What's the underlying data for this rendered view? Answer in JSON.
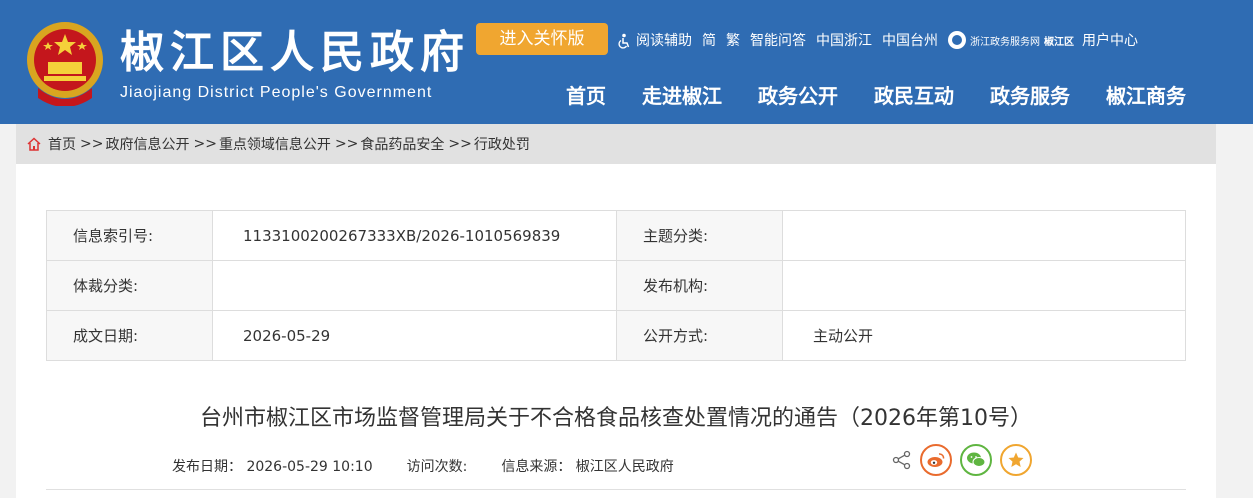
{
  "header": {
    "title": "椒江区人民政府",
    "subtitle": "Jiaojiang District People's Government",
    "care_button": "进入关怀版",
    "top_links": {
      "reading_aid": "阅读辅助",
      "simplified": "简",
      "traditional": "繁",
      "smart_qa": "智能问答",
      "china_zhejiang": "中国浙江",
      "china_taizhou": "中国台州",
      "zj_service": "浙江政务服务网",
      "zj_region": "椒江区",
      "user_center": "用户中心"
    },
    "nav": [
      "首页",
      "走进椒江",
      "政务公开",
      "政民互动",
      "政务服务",
      "椒江商务"
    ]
  },
  "breadcrumb": {
    "items": [
      "首页",
      "政府信息公开",
      "重点领域信息公开",
      "食品药品安全",
      "行政处罚"
    ],
    "separator": ">>"
  },
  "info": {
    "index_label": "信息索引号:",
    "index_value": "1133100200267333XB/2026-1010569839",
    "topic_label": "主题分类:",
    "topic_value": "",
    "genre_label": "体裁分类:",
    "genre_value": "",
    "issuer_label": "发布机构:",
    "issuer_value": "",
    "date_label": "成文日期:",
    "date_value": "2026-05-29",
    "disclosure_label": "公开方式:",
    "disclosure_value": "主动公开"
  },
  "article": {
    "title": "台州市椒江区市场监督管理局关于不合格食品核查处置情况的通告（2026年第10号）",
    "publish_date": "发布日期： 2026-05-29 10:10",
    "visits": "访问次数:",
    "source": "信息来源： 椒江区人民政府"
  },
  "colors": {
    "header_bg": "#2f6cb3",
    "care_button": "#f0a630",
    "weibo": "#e96b2e",
    "wechat": "#5fb541",
    "favorite": "#f0a630"
  },
  "icons": [
    "national-emblem-icon",
    "accessibility-icon",
    "zhejiang-globe-icon",
    "home-icon",
    "share-icon",
    "weibo-icon",
    "wechat-icon",
    "favorite-star-icon"
  ]
}
